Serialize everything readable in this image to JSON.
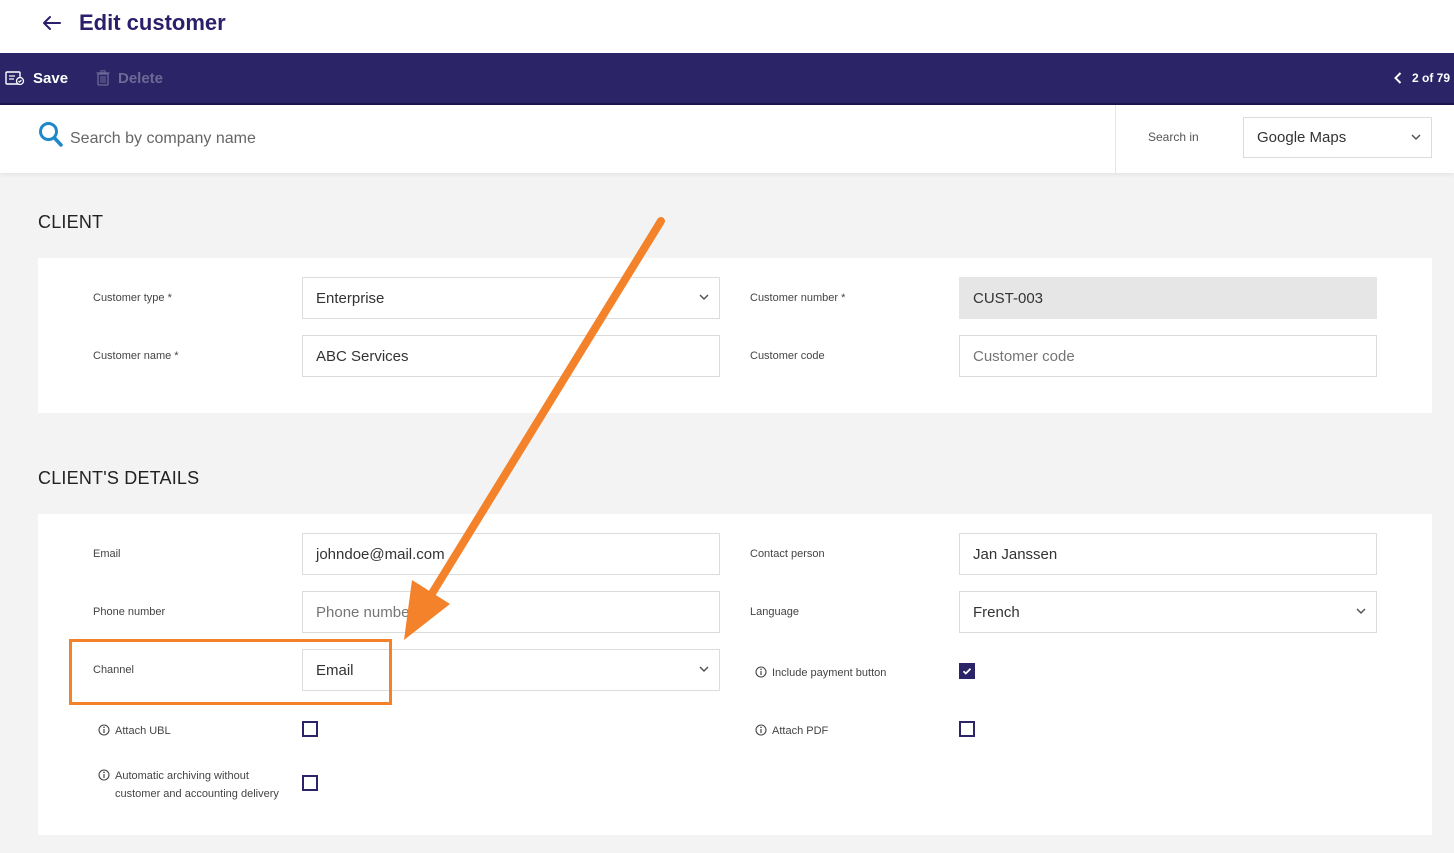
{
  "header": {
    "title": "Edit customer"
  },
  "toolbar": {
    "save_label": "Save",
    "delete_label": "Delete",
    "pager_text": "2 of 79"
  },
  "search": {
    "placeholder": "Search by company name",
    "search_in_label": "Search in",
    "search_in_value": "Google Maps"
  },
  "client": {
    "title": "CLIENT",
    "customer_type_label": "Customer type *",
    "customer_type_value": "Enterprise",
    "customer_number_label": "Customer number *",
    "customer_number_value": "CUST-003",
    "customer_name_label": "Customer name *",
    "customer_name_value": "ABC Services",
    "customer_code_label": "Customer code",
    "customer_code_placeholder": "Customer code"
  },
  "details": {
    "title": "CLIENT'S DETAILS",
    "email_label": "Email",
    "email_value": "johndoe@mail.com",
    "contact_label": "Contact person",
    "contact_value": "Jan Janssen",
    "phone_label": "Phone number",
    "phone_placeholder": "Phone number",
    "language_label": "Language",
    "language_value": "French",
    "channel_label": "Channel",
    "channel_value": "Email",
    "payment_button_label": "Include payment button",
    "payment_button_checked": true,
    "attach_ubl_label": "Attach UBL",
    "attach_ubl_checked": false,
    "attach_pdf_label": "Attach PDF",
    "attach_pdf_checked": false,
    "archiving_label_line1": "Automatic archiving without",
    "archiving_label_line2": "customer and accounting delivery",
    "archiving_checked": false
  },
  "annotation": {
    "color": "#f4822a"
  },
  "colors": {
    "brand": "#2b2466",
    "title": "#2b1f6b",
    "search_icon": "#1e88c9"
  }
}
